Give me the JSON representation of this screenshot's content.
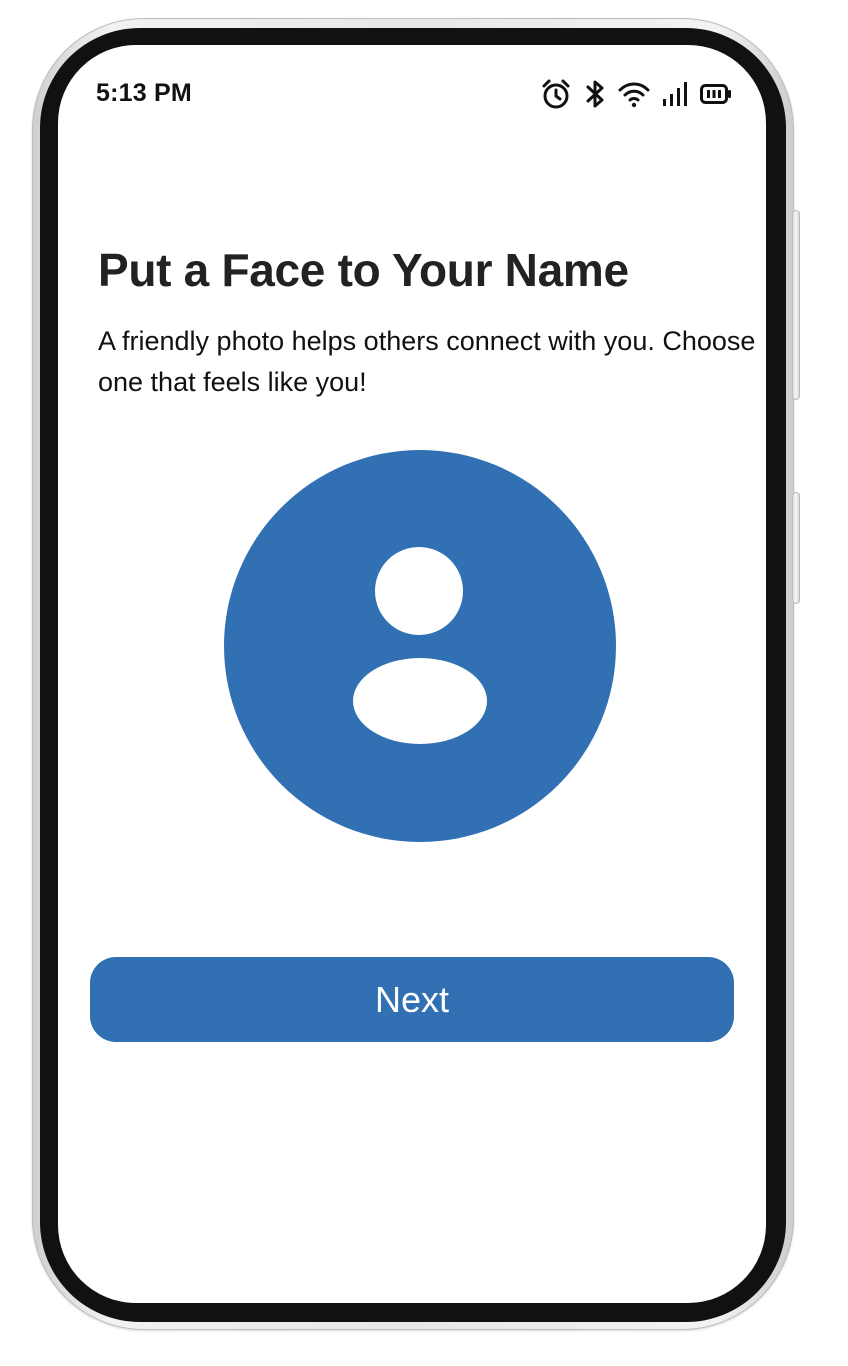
{
  "status_bar": {
    "time": "5:13 PM",
    "icons": [
      "alarm-icon",
      "bluetooth-icon",
      "wifi-icon",
      "signal-icon",
      "battery-icon"
    ]
  },
  "screen": {
    "title": "Put a Face to Your Name",
    "subtitle": "A friendly photo helps others connect with you. Choose one that feels like you!",
    "avatar_icon": "user-avatar-placeholder-icon",
    "next_label": "Next"
  },
  "colors": {
    "accent": "#3070b3",
    "title_text": "#222222",
    "body_text": "#111111",
    "background": "#ffffff"
  }
}
